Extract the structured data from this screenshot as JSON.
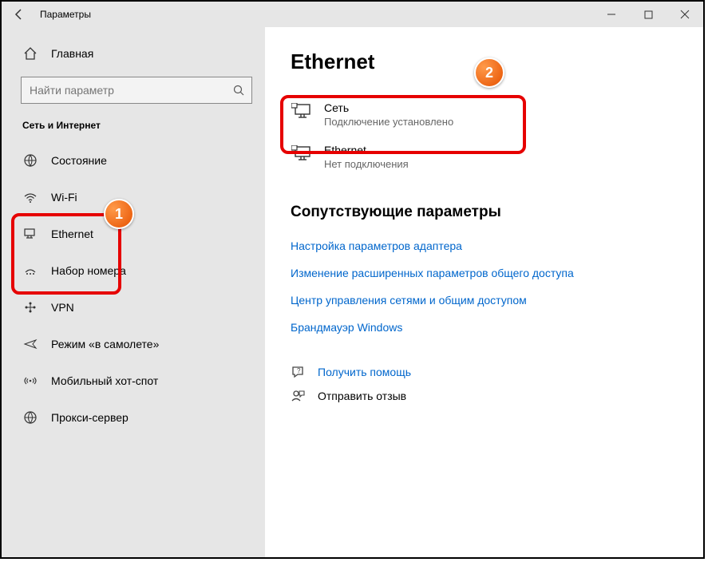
{
  "titlebar": {
    "title": "Параметры"
  },
  "sidebar": {
    "home": "Главная",
    "search_placeholder": "Найти параметр",
    "section": "Сеть и Интернет",
    "items": [
      {
        "label": "Состояние"
      },
      {
        "label": "Wi-Fi"
      },
      {
        "label": "Ethernet"
      },
      {
        "label": "Набор номера"
      },
      {
        "label": "VPN"
      },
      {
        "label": "Режим «в самолете»"
      },
      {
        "label": "Мобильный хот-спот"
      },
      {
        "label": "Прокси-сервер"
      }
    ]
  },
  "main": {
    "heading": "Ethernet",
    "networks": [
      {
        "name": "Сеть",
        "status": "Подключение установлено"
      },
      {
        "name": "Ethernet",
        "status": "Нет подключения"
      }
    ],
    "related_heading": "Сопутствующие параметры",
    "links": [
      "Настройка параметров адаптера",
      "Изменение расширенных параметров общего доступа",
      "Центр управления сетями и общим доступом",
      "Брандмауэр Windows"
    ],
    "help": "Получить помощь",
    "feedback": "Отправить отзыв"
  },
  "badges": {
    "b1": "1",
    "b2": "2"
  }
}
